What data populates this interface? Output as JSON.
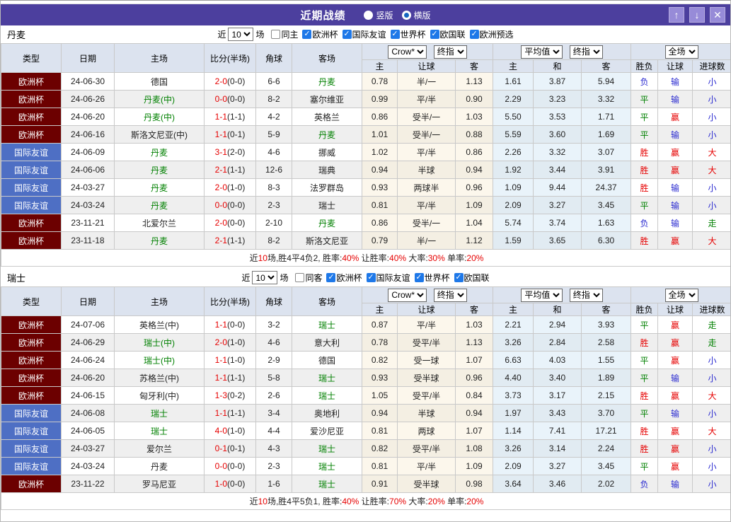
{
  "colors": {
    "titlebar": "#4c3f9e",
    "accent_red": "#e60000",
    "green": "#008000",
    "blue": "#2a2ad0",
    "euro_badge": "#6c0000",
    "friendly_badge": "#4e6fc4",
    "header_bg": "#dce3ef",
    "check_blue": "#1e78e8"
  },
  "icons": {
    "check": "✓"
  },
  "titlebar": {
    "title": "近期战绩",
    "layout_options": [
      {
        "label": "竖版",
        "selected": false
      },
      {
        "label": "横版",
        "selected": true
      }
    ],
    "buttons": [
      {
        "name": "move-up",
        "glyph": "↑"
      },
      {
        "name": "move-down",
        "glyph": "↓"
      },
      {
        "name": "close",
        "glyph": "✕"
      }
    ]
  },
  "table_header": {
    "cols": [
      "类型",
      "日期",
      "主场",
      "比分(半场)",
      "角球",
      "客场"
    ],
    "odds_group": {
      "dropdowns": [
        "Crow*",
        "终指"
      ],
      "cols": [
        "主",
        "让球",
        "客"
      ]
    },
    "avg_group": {
      "dropdowns": [
        "平均值",
        "终指"
      ],
      "cols": [
        "主",
        "和",
        "客"
      ]
    },
    "result_group": {
      "dropdown": "全场",
      "cols": [
        "胜负",
        "让球",
        "进球数"
      ]
    }
  },
  "sections": [
    {
      "team": "丹麦",
      "filter": {
        "near": "近",
        "count": "10",
        "games": "场",
        "same": "同主",
        "same_checked": false,
        "leagues": [
          "欧洲杯",
          "国际友谊",
          "世界杯",
          "欧国联",
          "欧洲预选"
        ]
      },
      "rows": [
        {
          "type": "欧洲杯",
          "tk": "euro",
          "date": "24-06-30",
          "home": "德国",
          "hh": false,
          "ft": "2-0",
          "ht": "(0-0)",
          "cor": "6-6",
          "away": "丹麦",
          "ah": true,
          "h1": "0.78",
          "hc": "半/一",
          "h2": "1.13",
          "m1": "1.61",
          "m2": "3.87",
          "m3": "5.94",
          "w": [
            "负",
            "b"
          ],
          "l": [
            "输",
            "b"
          ],
          "g": [
            "小",
            "b"
          ]
        },
        {
          "type": "欧洲杯",
          "tk": "euro",
          "date": "24-06-26",
          "home": "丹麦(中)",
          "hh": true,
          "ft": "0-0",
          "ht": "(0-0)",
          "cor": "8-2",
          "away": "塞尔维亚",
          "ah": false,
          "h1": "0.99",
          "hc": "平/半",
          "h2": "0.90",
          "m1": "2.29",
          "m2": "3.23",
          "m3": "3.32",
          "w": [
            "平",
            "g"
          ],
          "l": [
            "输",
            "b"
          ],
          "g": [
            "小",
            "b"
          ]
        },
        {
          "type": "欧洲杯",
          "tk": "euro",
          "date": "24-06-20",
          "home": "丹麦(中)",
          "hh": true,
          "ft": "1-1",
          "ht": "(1-1)",
          "cor": "4-2",
          "away": "英格兰",
          "ah": false,
          "h1": "0.86",
          "hc": "受半/一",
          "h2": "1.03",
          "m1": "5.50",
          "m2": "3.53",
          "m3": "1.71",
          "w": [
            "平",
            "g"
          ],
          "l": [
            "赢",
            "r"
          ],
          "g": [
            "小",
            "b"
          ]
        },
        {
          "type": "欧洲杯",
          "tk": "euro",
          "date": "24-06-16",
          "home": "斯洛文尼亚(中)",
          "hh": false,
          "ft": "1-1",
          "ht": "(0-1)",
          "cor": "5-9",
          "away": "丹麦",
          "ah": true,
          "h1": "1.01",
          "hc": "受半/一",
          "h2": "0.88",
          "m1": "5.59",
          "m2": "3.60",
          "m3": "1.69",
          "w": [
            "平",
            "g"
          ],
          "l": [
            "输",
            "b"
          ],
          "g": [
            "小",
            "b"
          ]
        },
        {
          "type": "国际友谊",
          "tk": "friendly",
          "date": "24-06-09",
          "home": "丹麦",
          "hh": true,
          "ft": "3-1",
          "ht": "(2-0)",
          "cor": "4-6",
          "away": "挪威",
          "ah": false,
          "h1": "1.02",
          "hc": "平/半",
          "h2": "0.86",
          "m1": "2.26",
          "m2": "3.32",
          "m3": "3.07",
          "w": [
            "胜",
            "r"
          ],
          "l": [
            "赢",
            "r"
          ],
          "g": [
            "大",
            "r"
          ]
        },
        {
          "type": "国际友谊",
          "tk": "friendly",
          "date": "24-06-06",
          "home": "丹麦",
          "hh": true,
          "ft": "2-1",
          "ht": "(1-1)",
          "cor": "12-6",
          "away": "瑞典",
          "ah": false,
          "h1": "0.94",
          "hc": "半球",
          "h2": "0.94",
          "m1": "1.92",
          "m2": "3.44",
          "m3": "3.91",
          "w": [
            "胜",
            "r"
          ],
          "l": [
            "赢",
            "r"
          ],
          "g": [
            "大",
            "r"
          ]
        },
        {
          "type": "国际友谊",
          "tk": "friendly",
          "date": "24-03-27",
          "home": "丹麦",
          "hh": true,
          "ft": "2-0",
          "ht": "(1-0)",
          "cor": "8-3",
          "away": "法罗群岛",
          "ah": false,
          "h1": "0.93",
          "hc": "两球半",
          "h2": "0.96",
          "m1": "1.09",
          "m2": "9.44",
          "m3": "24.37",
          "w": [
            "胜",
            "r"
          ],
          "l": [
            "输",
            "b"
          ],
          "g": [
            "小",
            "b"
          ]
        },
        {
          "type": "国际友谊",
          "tk": "friendly",
          "date": "24-03-24",
          "home": "丹麦",
          "hh": true,
          "ft": "0-0",
          "ht": "(0-0)",
          "cor": "2-3",
          "away": "瑞士",
          "ah": false,
          "h1": "0.81",
          "hc": "平/半",
          "h2": "1.09",
          "m1": "2.09",
          "m2": "3.27",
          "m3": "3.45",
          "w": [
            "平",
            "g"
          ],
          "l": [
            "输",
            "b"
          ],
          "g": [
            "小",
            "b"
          ]
        },
        {
          "type": "欧洲杯",
          "tk": "euro",
          "date": "23-11-21",
          "home": "北爱尔兰",
          "hh": false,
          "ft": "2-0",
          "ht": "(0-0)",
          "cor": "2-10",
          "away": "丹麦",
          "ah": true,
          "h1": "0.86",
          "hc": "受半/一",
          "h2": "1.04",
          "m1": "5.74",
          "m2": "3.74",
          "m3": "1.63",
          "w": [
            "负",
            "b"
          ],
          "l": [
            "输",
            "b"
          ],
          "g": [
            "走",
            "g"
          ]
        },
        {
          "type": "欧洲杯",
          "tk": "euro",
          "date": "23-11-18",
          "home": "丹麦",
          "hh": true,
          "ft": "2-1",
          "ht": "(1-1)",
          "cor": "8-2",
          "away": "斯洛文尼亚",
          "ah": false,
          "h1": "0.79",
          "hc": "半/一",
          "h2": "1.12",
          "m1": "1.59",
          "m2": "3.65",
          "m3": "6.30",
          "w": [
            "胜",
            "r"
          ],
          "l": [
            "赢",
            "r"
          ],
          "g": [
            "大",
            "r"
          ]
        }
      ],
      "summary": [
        [
          "近",
          0
        ],
        [
          "10",
          1
        ],
        [
          "场,胜4平4负2, 胜率:",
          0
        ],
        [
          "40%",
          1
        ],
        [
          " 让胜率:",
          0
        ],
        [
          "40%",
          1
        ],
        [
          " 大率:",
          0
        ],
        [
          "30%",
          1
        ],
        [
          " 单率:",
          0
        ],
        [
          "20%",
          1
        ]
      ]
    },
    {
      "team": "瑞士",
      "filter": {
        "near": "近",
        "count": "10",
        "games": "场",
        "same": "同客",
        "same_checked": false,
        "leagues": [
          "欧洲杯",
          "国际友谊",
          "世界杯",
          "欧国联"
        ]
      },
      "rows": [
        {
          "type": "欧洲杯",
          "tk": "euro",
          "date": "24-07-06",
          "home": "英格兰(中)",
          "hh": false,
          "ft": "1-1",
          "ht": "(0-0)",
          "cor": "3-2",
          "away": "瑞士",
          "ah": true,
          "h1": "0.87",
          "hc": "平/半",
          "h2": "1.03",
          "m1": "2.21",
          "m2": "2.94",
          "m3": "3.93",
          "w": [
            "平",
            "g"
          ],
          "l": [
            "赢",
            "r"
          ],
          "g": [
            "走",
            "g"
          ]
        },
        {
          "type": "欧洲杯",
          "tk": "euro",
          "date": "24-06-29",
          "home": "瑞士(中)",
          "hh": true,
          "ft": "2-0",
          "ht": "(1-0)",
          "cor": "4-6",
          "away": "意大利",
          "ah": false,
          "h1": "0.78",
          "hc": "受平/半",
          "h2": "1.13",
          "m1": "3.26",
          "m2": "2.84",
          "m3": "2.58",
          "w": [
            "胜",
            "r"
          ],
          "l": [
            "赢",
            "r"
          ],
          "g": [
            "走",
            "g"
          ]
        },
        {
          "type": "欧洲杯",
          "tk": "euro",
          "date": "24-06-24",
          "home": "瑞士(中)",
          "hh": true,
          "ft": "1-1",
          "ht": "(1-0)",
          "cor": "2-9",
          "away": "德国",
          "ah": false,
          "h1": "0.82",
          "hc": "受一球",
          "h2": "1.07",
          "m1": "6.63",
          "m2": "4.03",
          "m3": "1.55",
          "w": [
            "平",
            "g"
          ],
          "l": [
            "赢",
            "r"
          ],
          "g": [
            "小",
            "b"
          ]
        },
        {
          "type": "欧洲杯",
          "tk": "euro",
          "date": "24-06-20",
          "home": "苏格兰(中)",
          "hh": false,
          "ft": "1-1",
          "ht": "(1-1)",
          "cor": "5-8",
          "away": "瑞士",
          "ah": true,
          "h1": "0.93",
          "hc": "受半球",
          "h2": "0.96",
          "m1": "4.40",
          "m2": "3.40",
          "m3": "1.89",
          "w": [
            "平",
            "g"
          ],
          "l": [
            "输",
            "b"
          ],
          "g": [
            "小",
            "b"
          ]
        },
        {
          "type": "欧洲杯",
          "tk": "euro",
          "date": "24-06-15",
          "home": "匈牙利(中)",
          "hh": false,
          "ft": "1-3",
          "ht": "(0-2)",
          "cor": "2-6",
          "away": "瑞士",
          "ah": true,
          "h1": "1.05",
          "hc": "受平/半",
          "h2": "0.84",
          "m1": "3.73",
          "m2": "3.17",
          "m3": "2.15",
          "w": [
            "胜",
            "r"
          ],
          "l": [
            "赢",
            "r"
          ],
          "g": [
            "大",
            "r"
          ]
        },
        {
          "type": "国际友谊",
          "tk": "friendly",
          "date": "24-06-08",
          "home": "瑞士",
          "hh": true,
          "ft": "1-1",
          "ht": "(1-1)",
          "cor": "3-4",
          "away": "奥地利",
          "ah": false,
          "h1": "0.94",
          "hc": "半球",
          "h2": "0.94",
          "m1": "1.97",
          "m2": "3.43",
          "m3": "3.70",
          "w": [
            "平",
            "g"
          ],
          "l": [
            "输",
            "b"
          ],
          "g": [
            "小",
            "b"
          ]
        },
        {
          "type": "国际友谊",
          "tk": "friendly",
          "date": "24-06-05",
          "home": "瑞士",
          "hh": true,
          "ft": "4-0",
          "ht": "(1-0)",
          "cor": "4-4",
          "away": "爱沙尼亚",
          "ah": false,
          "h1": "0.81",
          "hc": "两球",
          "h2": "1.07",
          "m1": "1.14",
          "m2": "7.41",
          "m3": "17.21",
          "w": [
            "胜",
            "r"
          ],
          "l": [
            "赢",
            "r"
          ],
          "g": [
            "大",
            "r"
          ]
        },
        {
          "type": "国际友谊",
          "tk": "friendly",
          "date": "24-03-27",
          "home": "爱尔兰",
          "hh": false,
          "ft": "0-1",
          "ht": "(0-1)",
          "cor": "4-3",
          "away": "瑞士",
          "ah": true,
          "h1": "0.82",
          "hc": "受平/半",
          "h2": "1.08",
          "m1": "3.26",
          "m2": "3.14",
          "m3": "2.24",
          "w": [
            "胜",
            "r"
          ],
          "l": [
            "赢",
            "r"
          ],
          "g": [
            "小",
            "b"
          ]
        },
        {
          "type": "国际友谊",
          "tk": "friendly",
          "date": "24-03-24",
          "home": "丹麦",
          "hh": false,
          "ft": "0-0",
          "ht": "(0-0)",
          "cor": "2-3",
          "away": "瑞士",
          "ah": true,
          "h1": "0.81",
          "hc": "平/半",
          "h2": "1.09",
          "m1": "2.09",
          "m2": "3.27",
          "m3": "3.45",
          "w": [
            "平",
            "g"
          ],
          "l": [
            "赢",
            "r"
          ],
          "g": [
            "小",
            "b"
          ]
        },
        {
          "type": "欧洲杯",
          "tk": "euro",
          "date": "23-11-22",
          "home": "罗马尼亚",
          "hh": false,
          "ft": "1-0",
          "ht": "(0-0)",
          "cor": "1-6",
          "away": "瑞士",
          "ah": true,
          "h1": "0.91",
          "hc": "受半球",
          "h2": "0.98",
          "m1": "3.64",
          "m2": "3.46",
          "m3": "2.02",
          "w": [
            "负",
            "b"
          ],
          "l": [
            "输",
            "b"
          ],
          "g": [
            "小",
            "b"
          ]
        }
      ],
      "summary": [
        [
          "近",
          0
        ],
        [
          "10",
          1
        ],
        [
          "场,胜4平5负1, 胜率:",
          0
        ],
        [
          "40%",
          1
        ],
        [
          " 让胜率:",
          0
        ],
        [
          "70%",
          1
        ],
        [
          " 大率:",
          0
        ],
        [
          "20%",
          1
        ],
        [
          " 单率:",
          0
        ],
        [
          "20%",
          1
        ]
      ]
    }
  ]
}
